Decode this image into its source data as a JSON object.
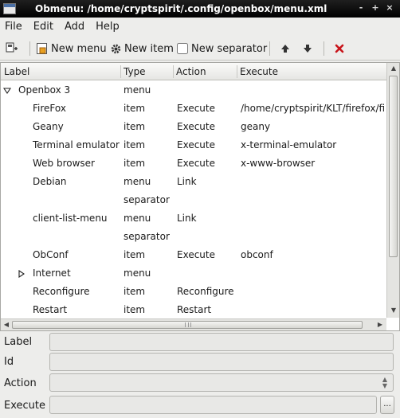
{
  "window": {
    "title": "Obmenu: /home/cryptspirit/.config/openbox/menu.xml",
    "controls": [
      "-",
      "+",
      "×"
    ]
  },
  "menubar": [
    "File",
    "Edit",
    "Add",
    "Help"
  ],
  "toolbar": {
    "new_menu": "New menu",
    "new_item": "New item",
    "new_separator": "New separator"
  },
  "tree": {
    "columns": [
      "Label",
      "Type",
      "Action",
      "Execute"
    ],
    "rows": [
      {
        "label": "Openbox 3",
        "type": "menu",
        "action": "",
        "execute": "",
        "expander": "expanded"
      },
      {
        "label": "FireFox",
        "type": "item",
        "action": "Execute",
        "execute": "/home/cryptspirit/KLT/firefox/fi",
        "expander": ""
      },
      {
        "label": "Geany",
        "type": "item",
        "action": "Execute",
        "execute": "geany",
        "expander": ""
      },
      {
        "label": "Terminal emulator",
        "type": "item",
        "action": "Execute",
        "execute": "x-terminal-emulator",
        "expander": ""
      },
      {
        "label": "Web browser",
        "type": "item",
        "action": "Execute",
        "execute": "x-www-browser",
        "expander": ""
      },
      {
        "label": "Debian",
        "type": "menu",
        "action": "Link",
        "execute": "",
        "expander": ""
      },
      {
        "label": "",
        "type": "separator",
        "action": "",
        "execute": "",
        "expander": ""
      },
      {
        "label": "client-list-menu",
        "type": "menu",
        "action": "Link",
        "execute": "",
        "expander": ""
      },
      {
        "label": "",
        "type": "separator",
        "action": "",
        "execute": "",
        "expander": ""
      },
      {
        "label": "ObConf",
        "type": "item",
        "action": "Execute",
        "execute": "obconf",
        "expander": ""
      },
      {
        "label": "Internet",
        "type": "menu",
        "action": "",
        "execute": "",
        "expander": "collapsed"
      },
      {
        "label": "Reconfigure",
        "type": "item",
        "action": "Reconfigure",
        "execute": "",
        "expander": ""
      },
      {
        "label": "Restart",
        "type": "item",
        "action": "Restart",
        "execute": "",
        "expander": ""
      }
    ]
  },
  "form": {
    "label": "Label",
    "id": "Id",
    "action": "Action",
    "execute": "Execute",
    "browse": "..."
  }
}
